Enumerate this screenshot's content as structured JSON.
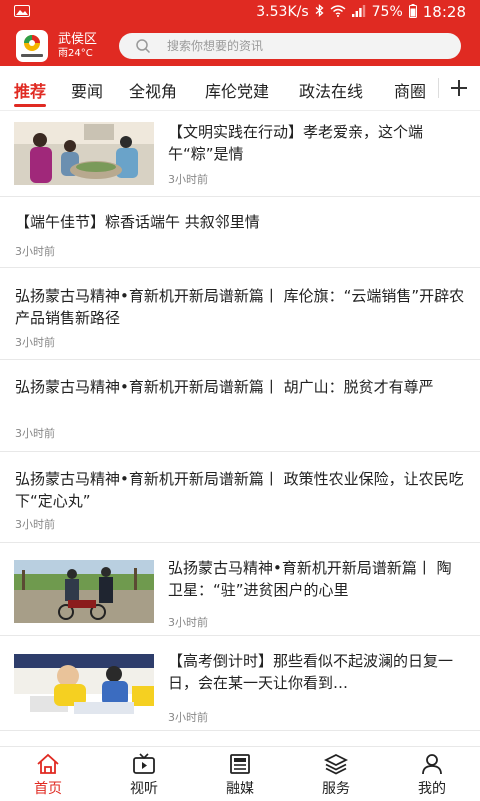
{
  "status_bar": {
    "speed": "3.53K/s",
    "battery": "75%",
    "time": "18:28"
  },
  "header": {
    "location": "武侯区",
    "weather": "雨24°C",
    "search_placeholder": "搜索你想要的资讯",
    "accent_color": "#e02a22"
  },
  "tabs": [
    {
      "label": "推荐",
      "active": true
    },
    {
      "label": "要闻"
    },
    {
      "label": "全视角"
    },
    {
      "label": "库伦党建"
    },
    {
      "label": "政法在线"
    },
    {
      "label": "商圈"
    }
  ],
  "feed": [
    {
      "title": "【文明实践在行动】孝老爱亲，这个端午“粽”是情",
      "time": "3小时前"
    },
    {
      "title": "【端午佳节】粽香话端午 共叙邻里情",
      "time": "3小时前"
    },
    {
      "title": "弘扬蒙古马精神•育新机开新局谱新篇丨 库伦旗：“云端销售”开辟农产品销售新路径",
      "time": "3小时前"
    },
    {
      "title": "弘扬蒙古马精神•育新机开新局谱新篇丨 胡广山：脱贫才有尊严",
      "time": "3小时前"
    },
    {
      "title": "弘扬蒙古马精神•育新机开新局谱新篇丨 政策性农业保险，让农民吃下“定心丸”",
      "time": "3小时前"
    },
    {
      "title": "弘扬蒙古马精神•育新机开新局谱新篇丨 陶卫星：“驻”进贫困户的心里",
      "time": "3小时前"
    },
    {
      "title": "【高考倒计时】那些看似不起波澜的日复一日，会在某一天让你看到…",
      "time": "3小时前"
    }
  ],
  "bottom_nav": [
    {
      "label": "首页",
      "icon": "home-icon",
      "active": true
    },
    {
      "label": "视听",
      "icon": "tv-icon"
    },
    {
      "label": "融媒",
      "icon": "newspaper-icon"
    },
    {
      "label": "服务",
      "icon": "layers-icon"
    },
    {
      "label": "我的",
      "icon": "user-icon"
    }
  ]
}
